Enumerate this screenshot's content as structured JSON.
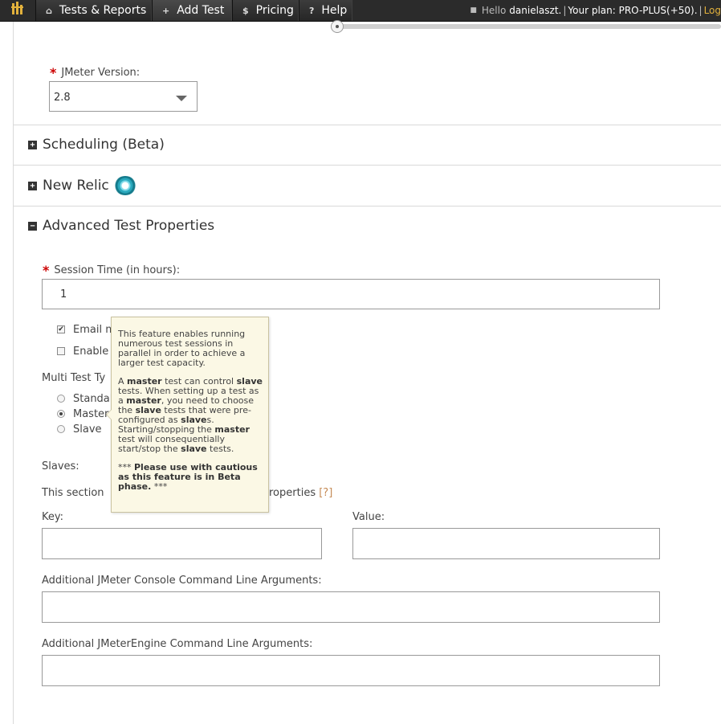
{
  "nav": {
    "items": [
      {
        "icon": "home-icon",
        "glyph": "⌂",
        "label": "Tests & Reports"
      },
      {
        "icon": "plus-icon",
        "glyph": "+",
        "label": "Add Test"
      },
      {
        "icon": "dollar-icon",
        "glyph": "$",
        "label": "Pricing"
      },
      {
        "icon": "question-icon",
        "glyph": "?",
        "label": "Help"
      }
    ],
    "user": {
      "hello": "Hello",
      "username": "danielaszt.",
      "separator": "|",
      "plan": "Your plan: PRO-PLUS(+50).",
      "logout": "Log"
    }
  },
  "jmeter_version": {
    "label": "JMeter Version:",
    "value": "2.8"
  },
  "sections": {
    "scheduling": {
      "toggle": "+",
      "title": "Scheduling (Beta)"
    },
    "new_relic": {
      "toggle": "+",
      "title": "New Relic"
    },
    "advanced": {
      "toggle": "−",
      "title": "Advanced Test Properties"
    }
  },
  "session_time": {
    "label": "Session Time (in hours):",
    "value": "1"
  },
  "checkboxes": {
    "email": {
      "label": "Email m",
      "checked": "✔"
    },
    "enable": {
      "label": "Enable"
    }
  },
  "multi_test": {
    "label": "Multi Test Ty",
    "options": [
      "Standal",
      "Master",
      "Slave"
    ]
  },
  "slaves_label": "Slaves:",
  "section_text": {
    "left": "This section",
    "right": "roperties",
    "help": "[?]"
  },
  "properties": {
    "key_label": "Key:",
    "value_label": "Value:",
    "key_value": "",
    "value_value": ""
  },
  "console_args": {
    "label": "Additional JMeter Console Command Line Arguments:",
    "value": ""
  },
  "engine_args": {
    "label": "Additional JMeterEngine Command Line Arguments:",
    "value": ""
  },
  "tooltip": {
    "p1": "This feature enables running numerous test sessions in parallel in order to achieve a larger test capacity.",
    "p2_a": "A ",
    "p2_master1": "master",
    "p2_b": " test can control ",
    "p2_slave1": "slave",
    "p2_c": " tests. When setting up a test as a ",
    "p2_master2": "master",
    "p2_d": ", you need to choose the ",
    "p2_slave2": "slave",
    "p2_e": " tests that were pre-configured as ",
    "p2_slave3": "slave",
    "p2_f": "s. Starting/stopping the ",
    "p2_master3": "master",
    "p2_g": " test will consequentially start/stop the ",
    "p2_slave4": "slave",
    "p2_h": " tests.",
    "p3_a": "*** ",
    "p3_bold": "Please use with cautious as this feature is in Beta phase.",
    "p3_b": " ***"
  },
  "colors": {
    "nav_bg": "#2b2b2b",
    "accent": "#e2b13c",
    "required": "#cc0000",
    "tooltip_bg": "#fbf8e5"
  }
}
